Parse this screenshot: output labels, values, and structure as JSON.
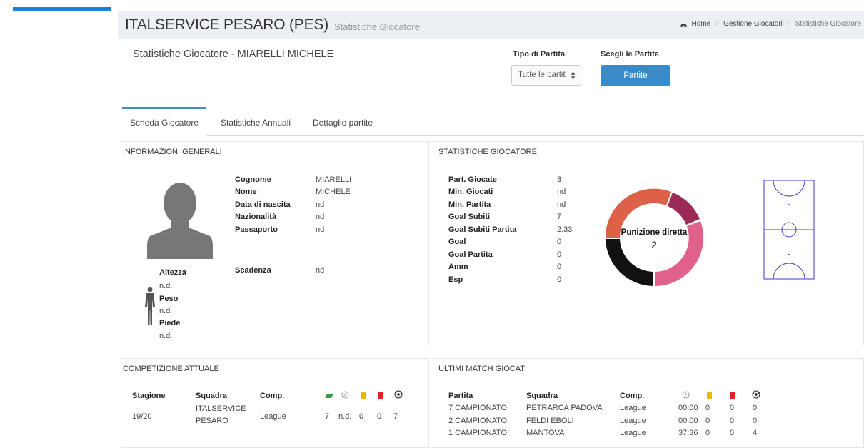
{
  "header": {
    "title": "ITALSERVICE PESARO (PES)",
    "subtitle": "Statistiche Giocatore",
    "breadcrumb": [
      "Home",
      "Gestione Giocatori",
      "Statistiche Giocatore"
    ],
    "breadcrumb_sep": ">"
  },
  "page": {
    "heading": "Statistiche Giocatore - MIARELLI MICHELE",
    "match_type_label": "Tipo di Partita",
    "match_type_value": "Tutte le partit",
    "choose_label": "Scegli le Partite",
    "choose_button": "Partite"
  },
  "tabs": [
    {
      "label": "Scheda Giocatore",
      "active": true
    },
    {
      "label": "Statistiche Annuali",
      "active": false
    },
    {
      "label": "Dettaglio partite",
      "active": false
    }
  ],
  "general_info": {
    "title": "INFORMAZIONI GENERALI",
    "fields": [
      {
        "label": "Cognome",
        "value": "MIARELLI"
      },
      {
        "label": "Nome",
        "value": "MICHELE"
      },
      {
        "label": "Data di nascita",
        "value": "nd"
      },
      {
        "label": "Nazionalità",
        "value": "nd"
      },
      {
        "label": "Passaporto",
        "value": "nd"
      }
    ],
    "expiry_label": "Scadenza",
    "expiry_value": "nd",
    "height_label": "Altezza",
    "height_value": "n.d.",
    "weight_label": "Peso",
    "weight_value": "n.d.",
    "foot_label": "Piede",
    "foot_value": "n.d."
  },
  "player_stats": {
    "title": "STATISTICHE GIOCATORE",
    "rows": [
      {
        "label": "Part. Giocate",
        "value": "3"
      },
      {
        "label": "Min. Giocati",
        "value": "nd"
      },
      {
        "label": "Min. Partita",
        "value": "nd"
      },
      {
        "label": "Goal Subiti",
        "value": "7"
      },
      {
        "label": "Goal Subiti Partita",
        "value": "2.33"
      },
      {
        "label": "Goal",
        "value": "0"
      },
      {
        "label": "Goal Partita",
        "value": "0"
      },
      {
        "label": "Amm",
        "value": "0"
      },
      {
        "label": "Esp",
        "value": "0"
      }
    ],
    "donut_center_label": "Punizione diretta",
    "donut_center_value": "2",
    "donut_colors": [
      "#dd6146",
      "#9b2a58",
      "#e0628a",
      "#111111"
    ]
  },
  "current_competition": {
    "title": "COMPETIZIONE ATTUALE",
    "headers": [
      "Stagione",
      "Squadra",
      "Comp."
    ],
    "icons": [
      "pitch-icon",
      "clock-icon",
      "yellow-card-icon",
      "red-card-icon",
      "ball-icon"
    ],
    "rows": [
      {
        "season": "19/20",
        "team_line1": "ITALSERVICE",
        "team_line2": "PESARO",
        "comp": "League",
        "played": "7",
        "minutes": "n.d.",
        "yellow": "0",
        "red": "0",
        "goals": "7"
      }
    ]
  },
  "last_matches": {
    "title": "ULTIMI MATCH GIOCATI",
    "headers": [
      "Partita",
      "Squadra",
      "Comp."
    ],
    "icons": [
      "clock-icon",
      "yellow-card-icon",
      "red-card-icon",
      "ball-icon"
    ],
    "rows": [
      {
        "match": "7 CAMPIONATO",
        "team": "PETRARCA PADOVA",
        "comp": "League",
        "time": "00:00",
        "yellow": "0",
        "red": "0",
        "goals": "0"
      },
      {
        "match": "2 CAMPIONATO",
        "team": "FELDI EBOLI",
        "comp": "League",
        "time": "00:00",
        "yellow": "0",
        "red": "0",
        "goals": "0"
      },
      {
        "match": "1 CAMPIONATO",
        "team": "MANTOVA",
        "comp": "League",
        "time": "37:36",
        "yellow": "0",
        "red": "0",
        "goals": "4"
      }
    ]
  },
  "colors": {
    "accent": "#3c8dbc",
    "button": "#3a8ac8",
    "topbar": "#1f7fd1",
    "yellow_card": "#f5b400",
    "red_card": "#e02424"
  }
}
